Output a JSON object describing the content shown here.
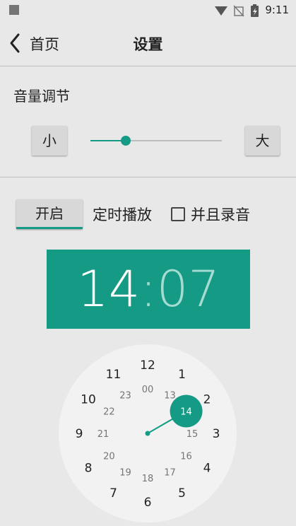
{
  "status_bar": {
    "time": "9:11"
  },
  "toolbar": {
    "back_label": "首页",
    "title": "设置"
  },
  "volume": {
    "title": "音量调节",
    "decrease_label": "小",
    "increase_label": "大",
    "level_fraction": 0.27
  },
  "timer": {
    "open_label": "开启",
    "label": "定时播放",
    "record_label": "并且录音",
    "record_checked": false
  },
  "time_picker": {
    "hour": "14",
    "separator": ":",
    "minute": "07",
    "selected_hour": 14,
    "outer_hours": [
      "12",
      "1",
      "2",
      "3",
      "4",
      "5",
      "6",
      "7",
      "8",
      "9",
      "10",
      "11"
    ],
    "inner_hours": [
      "00",
      "13",
      "14",
      "15",
      "16",
      "17",
      "18",
      "19",
      "20",
      "21",
      "22",
      "23"
    ]
  },
  "colors": {
    "accent": "#159a85",
    "accent_light": "#a4dcd2",
    "background": "#e8e8e8"
  }
}
